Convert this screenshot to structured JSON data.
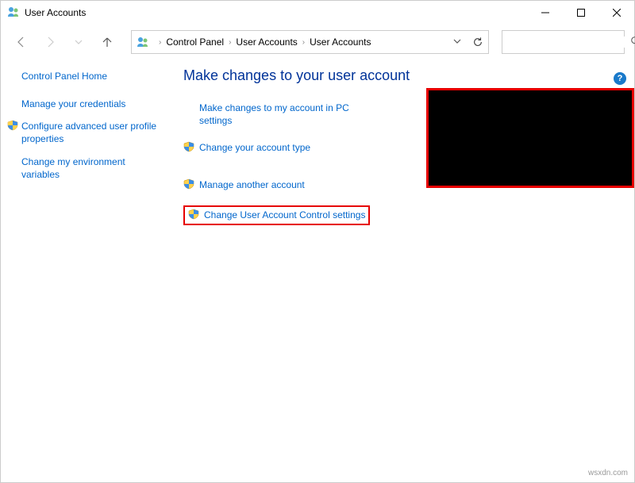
{
  "titlebar": {
    "title": "User Accounts"
  },
  "breadcrumb": {
    "items": [
      "Control Panel",
      "User Accounts",
      "User Accounts"
    ]
  },
  "search": {
    "placeholder": ""
  },
  "sidebar": {
    "home": "Control Panel Home",
    "links": [
      {
        "label": "Manage your credentials",
        "shield": false
      },
      {
        "label": "Configure advanced user profile properties",
        "shield": true
      },
      {
        "label": "Change my environment variables",
        "shield": false
      }
    ]
  },
  "main": {
    "heading": "Make changes to your user account",
    "tasks": [
      {
        "label": "Make changes to my account in PC settings",
        "shield": false
      },
      {
        "label": "Change your account type",
        "shield": true
      },
      {
        "label": "Manage another account",
        "shield": true
      },
      {
        "label": "Change User Account Control settings",
        "shield": true,
        "highlighted": true
      }
    ]
  },
  "help": {
    "label": "?"
  },
  "watermark": "wsxdn.com"
}
